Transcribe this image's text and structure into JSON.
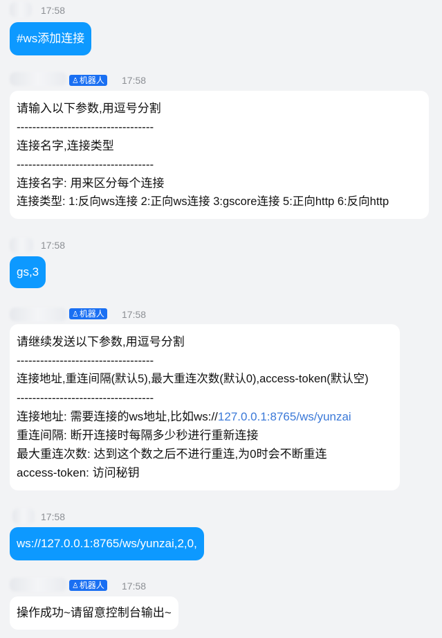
{
  "messages": [
    {
      "sender": "self",
      "time": "17:58",
      "text": "#ws添加连接"
    },
    {
      "sender": "bot",
      "badge": "机器人",
      "time": "17:58",
      "lines": [
        "请输入以下参数,用逗号分割",
        "-----------------------------------",
        "连接名字,连接类型",
        "-----------------------------------",
        "连接名字: 用来区分每个连接",
        "连接类型: 1:反向ws连接 2:正向ws连接 3:gscore连接 5:正向http 6:反向http"
      ]
    },
    {
      "sender": "self",
      "time": "17:58",
      "text": "gs,3"
    },
    {
      "sender": "bot",
      "badge": "机器人",
      "time": "17:58",
      "lines": [
        "请继续发送以下参数,用逗号分割",
        "-----------------------------------",
        "连接地址,重连间隔(默认5),最大重连次数(默认0),access-token(默认空)",
        "-----------------------------------",
        "连接地址: 需要连接的ws地址,比如ws://",
        "重连间隔: 断开连接时每隔多少秒进行重新连接",
        "最大重连次数: 达到这个数之后不进行重连,为0时会不断重连",
        "access-token: 访问秘钥"
      ],
      "link": "127.0.0.1:8765/ws/yunzai"
    },
    {
      "sender": "self",
      "time": "17:58",
      "text": "ws://127.0.0.1:8765/ws/yunzai,2,0,"
    },
    {
      "sender": "bot",
      "badge": "机器人",
      "time": "17:58",
      "lines": [
        "操作成功~请留意控制台输出~"
      ]
    }
  ],
  "colors": {
    "self_bubble": "#0d99ff",
    "bot_badge": "#1a6ff2",
    "link": "#3b79d8",
    "background": "#f2f3f5"
  },
  "icons": {
    "bot_badge_icon": "robot-icon"
  }
}
